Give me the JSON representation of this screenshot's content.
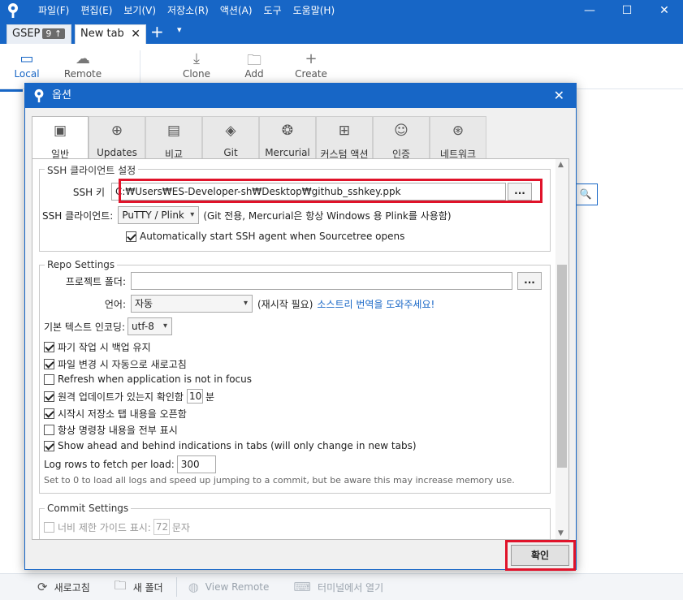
{
  "app": {
    "menu": [
      "파일(F)",
      "편집(E)",
      "보기(V)",
      "저장소(R)",
      "액션(A)",
      "도구",
      "도움말(H)"
    ],
    "window_controls": {
      "minimize": "—",
      "maximize": "☐",
      "close": "✕"
    }
  },
  "tabs": {
    "repo_tab": {
      "label": "GSEP",
      "badge": "9 ↑"
    },
    "new_tab": {
      "label": "New tab",
      "close": "✕"
    },
    "add": "+",
    "dropdown": "▾"
  },
  "toolbar": {
    "local": "Local",
    "remote": "Remote",
    "clone": "Clone",
    "add": "Add",
    "create": "Create"
  },
  "bottombar": {
    "refresh": "새로고침",
    "new_folder": "새 폴더",
    "view_remote": "View Remote",
    "open_terminal": "터미널에서 열기"
  },
  "dialog": {
    "title": "옵션",
    "close": "✕",
    "tabs": [
      {
        "label": "일반",
        "icon": "toggle-icon"
      },
      {
        "label": "Updates",
        "icon": "download-icon"
      },
      {
        "label": "비교",
        "icon": "diff-icon"
      },
      {
        "label": "Git",
        "icon": "git-icon"
      },
      {
        "label": "Mercurial",
        "icon": "mercurial-icon"
      },
      {
        "label": "커스텀 액션",
        "icon": "custom-action-icon"
      },
      {
        "label": "인증",
        "icon": "user-icon"
      },
      {
        "label": "네트워크",
        "icon": "globe-icon"
      }
    ],
    "ssh": {
      "group_title": "SSH 클라이언트 설정",
      "key_label": "SSH 키",
      "key_value": "C:₩Users₩ES-Developer-sh₩Desktop₩github_sshkey.ppk",
      "browse": "...",
      "client_label": "SSH 클라이언트:",
      "client_value": "PuTTY / Plink",
      "client_note": "(Git 전용, Mercurial은 항상 Windows 용 Plink를 사용함)",
      "auto_agent": "Automatically start SSH agent when Sourcetree opens"
    },
    "repo": {
      "group_title": "Repo Settings",
      "project_folder_label": "프로젝트 폴더:",
      "project_folder_value": "",
      "browse": "...",
      "language_label": "언어:",
      "language_value": "자동",
      "restart_note": "(재시작 필요)",
      "translate_link": "소스트리 번역을 도와주세요!",
      "encoding_label": "기본 텍스트 인코딩:",
      "encoding_value": "utf-8",
      "opt_backup": "파기 작업 시 백업 유지",
      "opt_auto_refresh": "파일 변경 시 자동으로 새로고침",
      "opt_refresh_focus": "Refresh when application is not in focus",
      "opt_check_updates": "원격 업데이트가 있는지 확인함",
      "update_minutes": "10",
      "update_unit": "분",
      "opt_open_tabs": "시작시 저장소 탭 내용을 오픈함",
      "opt_show_cmd": "항상 명령창 내용을 전부 표시",
      "opt_ahead_behind": "Show ahead and behind indications in tabs (will only change in new tabs)",
      "log_rows_label": "Log rows to fetch per load:",
      "log_rows_value": "300",
      "log_rows_note": "Set to 0 to load all logs and speed up jumping to a commit, but be aware this may increase memory use."
    },
    "commit": {
      "group_title": "Commit Settings",
      "width_guide_label": "너비 제한 가이드 표시:",
      "width_value": "72",
      "width_unit": "문자"
    },
    "ok": "확인"
  },
  "colors": {
    "brand": "#1766c6",
    "highlight": "#e0132a"
  }
}
